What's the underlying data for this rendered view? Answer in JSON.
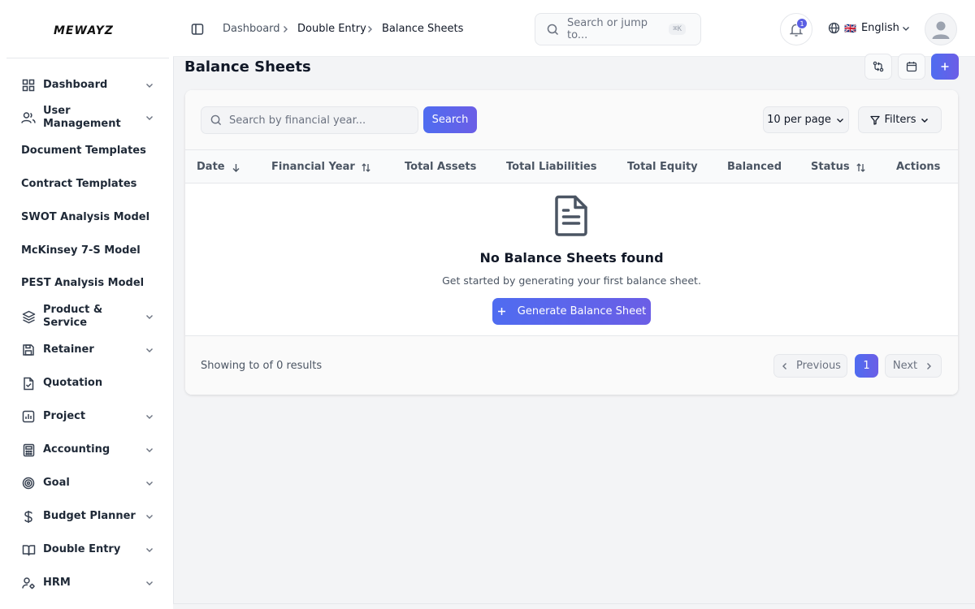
{
  "brand": {
    "logo": "MEWAYZ"
  },
  "sidebar": {
    "items": [
      {
        "label": "Dashboard",
        "icon": "grid-icon",
        "has_children": true
      },
      {
        "label": "User Management",
        "icon": "users-icon",
        "has_children": true
      },
      {
        "label": "Document Templates",
        "icon": "",
        "has_children": false
      },
      {
        "label": "Contract Templates",
        "icon": "",
        "has_children": false
      },
      {
        "label": "SWOT Analysis Model",
        "icon": "",
        "has_children": false
      },
      {
        "label": "McKinsey 7-S Model",
        "icon": "",
        "has_children": false
      },
      {
        "label": "PEST Analysis Model",
        "icon": "",
        "has_children": false
      },
      {
        "label": "Product & Service",
        "icon": "layers-icon",
        "has_children": true
      },
      {
        "label": "Retainer",
        "icon": "save-icon",
        "has_children": true
      },
      {
        "label": "Quotation",
        "icon": "file-check-icon",
        "has_children": false
      },
      {
        "label": "Project",
        "icon": "chart-icon",
        "has_children": true
      },
      {
        "label": "Accounting",
        "icon": "calculator-icon",
        "has_children": true
      },
      {
        "label": "Goal",
        "icon": "target-icon",
        "has_children": true
      },
      {
        "label": "Budget Planner",
        "icon": "dollar-icon",
        "has_children": true
      },
      {
        "label": "Double Entry",
        "icon": "book-icon",
        "has_children": true
      },
      {
        "label": "HRM",
        "icon": "user-cog-icon",
        "has_children": true
      }
    ]
  },
  "topbar": {
    "breadcrumb": [
      "Dashboard",
      "Double Entry",
      "Balance Sheets"
    ],
    "search_placeholder": "Search or jump to...",
    "search_shortcut": "⌘K",
    "notification_count": "1",
    "language": "English",
    "language_flag": "🇬🇧"
  },
  "page": {
    "title": "Balance Sheets"
  },
  "toolbar": {
    "search_placeholder": "Search by financial year...",
    "search_button": "Search",
    "per_page": "10 per page",
    "filters": "Filters"
  },
  "table": {
    "columns": [
      {
        "label": "Date",
        "sort": "desc"
      },
      {
        "label": "Financial Year",
        "sort": "both"
      },
      {
        "label": "Total Assets",
        "sort": ""
      },
      {
        "label": "Total Liabilities",
        "sort": ""
      },
      {
        "label": "Total Equity",
        "sort": ""
      },
      {
        "label": "Balanced",
        "sort": ""
      },
      {
        "label": "Status",
        "sort": "both"
      },
      {
        "label": "Actions",
        "sort": ""
      }
    ],
    "rows": []
  },
  "empty_state": {
    "title": "No Balance Sheets found",
    "subtitle": "Get started by generating your first balance sheet.",
    "button": "Generate Balance Sheet"
  },
  "pagination": {
    "summary": "Showing to of 0 results",
    "previous": "Previous",
    "current_page": "1",
    "next": "Next"
  },
  "colors": {
    "accent": "#5b66ea",
    "text": "#111827",
    "muted": "#4b5563"
  }
}
